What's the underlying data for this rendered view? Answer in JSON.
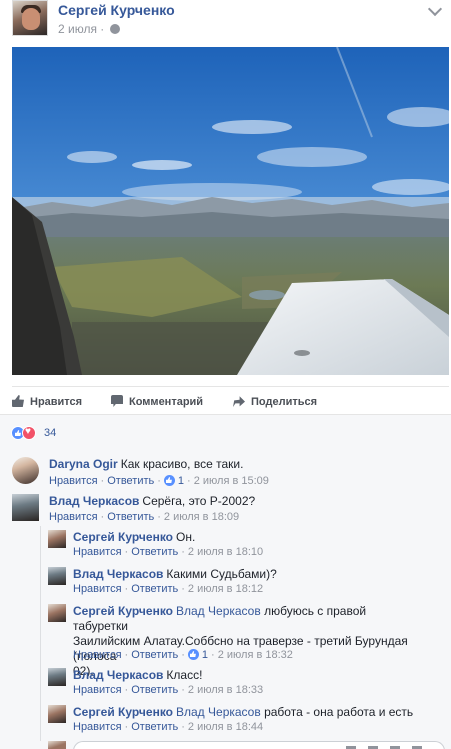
{
  "post": {
    "author": "Сергей Курченко",
    "date": "2 июля",
    "privacy_icon": "globe-icon",
    "menu_icon": "chevron-down-icon"
  },
  "actions": {
    "like": "Нравится",
    "comment": "Комментарий",
    "share": "Поделиться"
  },
  "reactions": {
    "types": [
      "like",
      "love"
    ],
    "count": "34",
    "colors": {
      "like": "#5890ff",
      "love": "#f25268"
    }
  },
  "comment_links": {
    "like": "Нравится",
    "reply": "Ответить",
    "separator": "·"
  },
  "comments": [
    {
      "author": "Daryna Ogir",
      "mention": "",
      "text": "Как красиво, все таки.",
      "likes": "1",
      "time": "2 июля в 15:09"
    },
    {
      "author": "Влад Черкасов",
      "mention": "",
      "text": "Серёга, это Р-2002?",
      "likes": "",
      "time": "2 июля в 18:09"
    }
  ],
  "replies": [
    {
      "author": "Сергей Курченко",
      "mention": "",
      "text": "Он.",
      "likes": "",
      "time": "2 июля в 18:10"
    },
    {
      "author": "Влад Черкасов",
      "mention": "",
      "text": "Какими Судьбами)?",
      "likes": "",
      "time": "2 июля в 18:12"
    },
    {
      "author": "Сергей Курченко",
      "mention": "Влад Черкасов",
      "text": "любуюсь с правой табуретки",
      "text2": "Заилийским Алатау.Соббсно на траверзе - третий Бурундая (полоса",
      "text3": "02).",
      "likes": "1",
      "time": "2 июля в 18:32"
    },
    {
      "author": "Влад Черкасов",
      "mention": "",
      "text": "Класс!",
      "likes": "",
      "time": "2 июля в 18:33"
    },
    {
      "author": "Сергей Курченко",
      "mention": "Влад Черкасов",
      "text": "работа - она работа и есть",
      "likes": "",
      "time": "2 июля в 18:44"
    }
  ],
  "colors": {
    "link": "#365899",
    "meta": "#90949c",
    "panel": "#f6f7f9"
  }
}
